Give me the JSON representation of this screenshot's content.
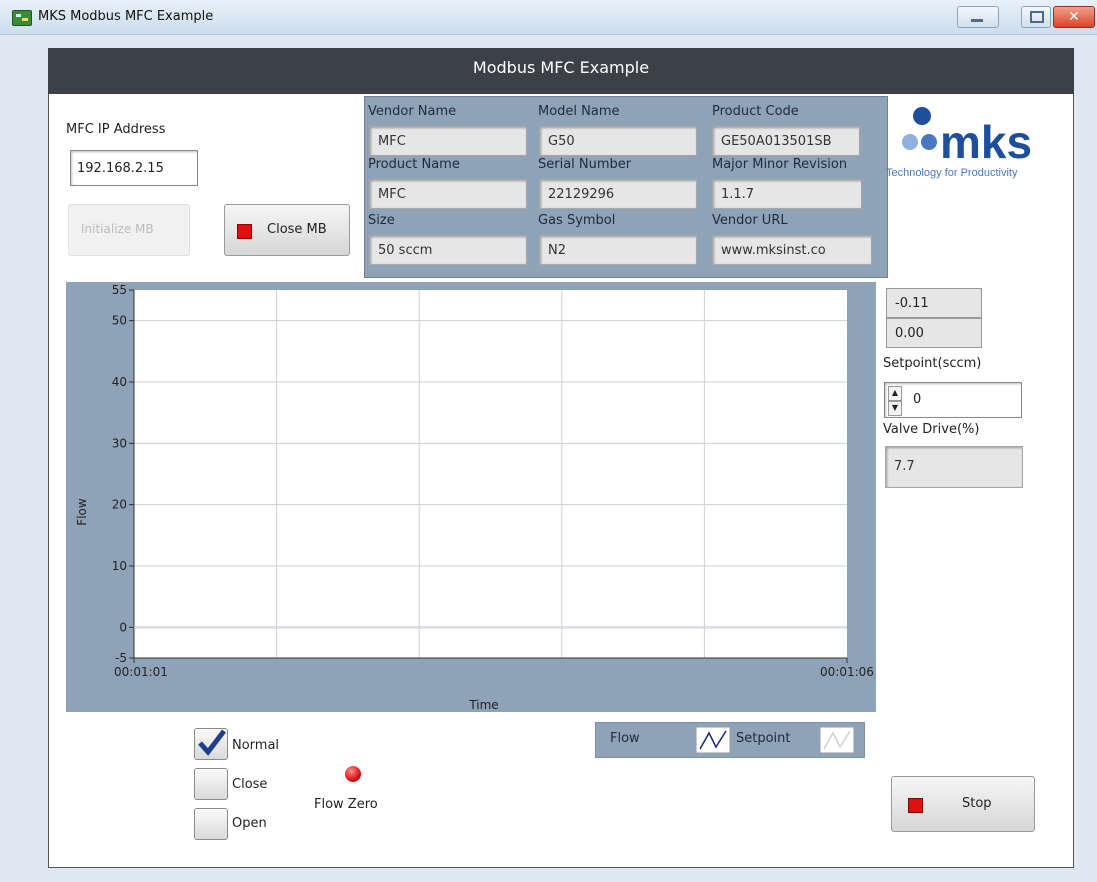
{
  "window": {
    "title": "MKS Modbus MFC Example"
  },
  "header": {
    "title": "Modbus MFC Example"
  },
  "connection": {
    "ip_label": "MFC IP Address",
    "ip_value": "192.168.2.15",
    "init_button": "Initialize MB",
    "close_button": "Close MB"
  },
  "device_info": {
    "vendor_name": {
      "label": "Vendor Name",
      "value": "MFC"
    },
    "model_name": {
      "label": "Model Name",
      "value": "G50"
    },
    "product_code": {
      "label": "Product Code",
      "value": "GE50A013501SB"
    },
    "product_name": {
      "label": "Product Name",
      "value": "MFC"
    },
    "serial_number": {
      "label": "Serial Number",
      "value": "22129296"
    },
    "revision": {
      "label": "Major Minor Revision",
      "value": "1.1.7"
    },
    "size": {
      "label": "Size",
      "value": "50  sccm"
    },
    "gas_symbol": {
      "label": "Gas Symbol",
      "value": "N2"
    },
    "vendor_url": {
      "label": "Vendor URL",
      "value": "www.mksinst.co"
    }
  },
  "logo": {
    "brand": "mks",
    "tagline": "Technology for Productivity",
    "color": "#1d4f9c"
  },
  "readouts": {
    "flow": "-0.11",
    "setpoint_readback": "0.00",
    "setpoint_label": "Setpoint(sccm)",
    "setpoint_value": "0",
    "valve_label": "Valve Drive(%)",
    "valve_value": "7.7"
  },
  "chart_data": {
    "type": "line",
    "xlabel": "Time",
    "ylabel": "Flow",
    "x_tick_labels": [
      "00:01:01",
      "00:01:06"
    ],
    "y_ticks": [
      -5,
      0,
      10,
      20,
      30,
      40,
      50,
      55
    ],
    "ylim": [
      -5,
      55
    ],
    "grid": true,
    "series": [
      {
        "name": "Flow",
        "values": [
          0,
          0
        ],
        "color": "#1a237e"
      },
      {
        "name": "Setpoint",
        "values": [
          0,
          0
        ],
        "color": "#e0e0e0"
      }
    ]
  },
  "legend": {
    "flow_label": "Flow",
    "setpoint_label": "Setpoint"
  },
  "valve_mode": {
    "normal": "Normal",
    "close": "Close",
    "open": "Open",
    "selected": "Normal"
  },
  "flow_zero": {
    "label": "Flow Zero"
  },
  "stop_button": "Stop"
}
